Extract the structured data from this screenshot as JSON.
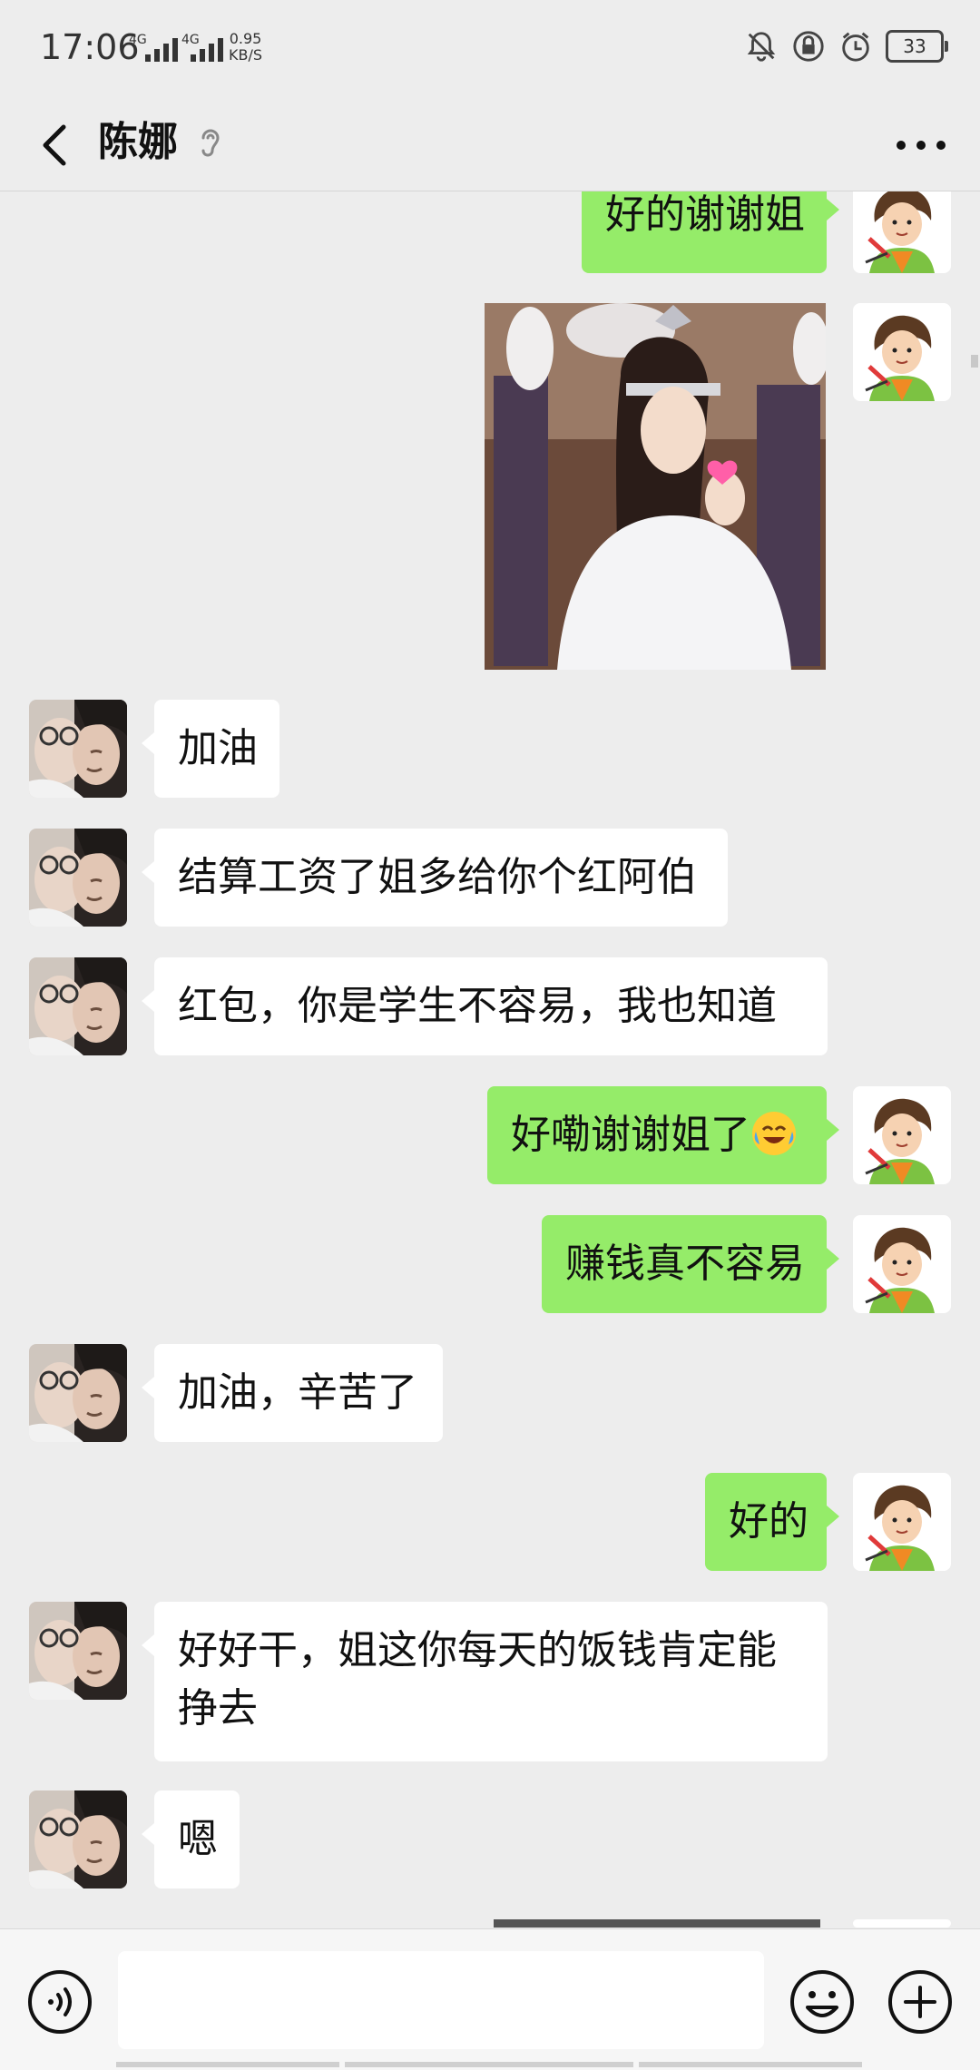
{
  "status_bar": {
    "time": "17:06",
    "network_1": "4G",
    "network_2": "4G",
    "speed_value": "0.95",
    "speed_unit": "KB/S",
    "battery": "33"
  },
  "header": {
    "title": "陈娜"
  },
  "messages": [
    {
      "side": "out",
      "type": "text",
      "text": "好的谢谢姐"
    },
    {
      "side": "out",
      "type": "sticker"
    },
    {
      "side": "in",
      "type": "text",
      "text": "加油"
    },
    {
      "side": "in",
      "type": "text",
      "text": "结算工资了姐多给你个红阿伯"
    },
    {
      "side": "in",
      "type": "text",
      "text": "红包，你是学生不容易，我也知道"
    },
    {
      "side": "out",
      "type": "text",
      "text": "好嘞谢谢姐了"
    },
    {
      "side": "out",
      "type": "text",
      "text": "赚钱真不容易"
    },
    {
      "side": "in",
      "type": "text",
      "text": "加油，辛苦了"
    },
    {
      "side": "out",
      "type": "text",
      "text": "好的"
    },
    {
      "side": "in",
      "type": "text",
      "text": "好好干，姐这你每天的饭钱肯定能挣去"
    },
    {
      "side": "in",
      "type": "text",
      "text": "嗯"
    },
    {
      "side": "out",
      "type": "sticker"
    }
  ],
  "colors": {
    "background": "#ededed",
    "outgoing_bubble": "#95ec69",
    "incoming_bubble": "#ffffff"
  },
  "icons": {
    "back": "chevron-left-icon",
    "more": "more-dots-icon",
    "voice": "voice-input-icon",
    "emoji": "smiley-icon",
    "plus": "plus-circle-icon"
  },
  "input": {
    "value": ""
  }
}
